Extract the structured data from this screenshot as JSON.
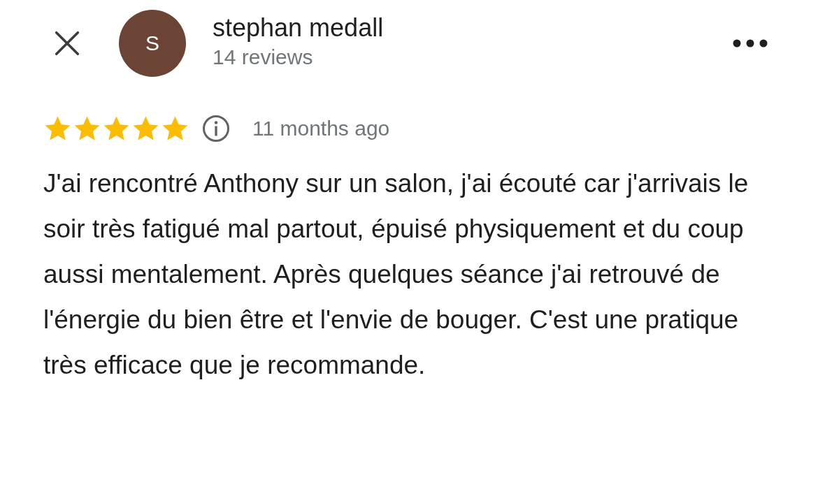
{
  "reviewer": {
    "initial": "S",
    "name": "stephan medall",
    "review_count": "14 reviews"
  },
  "review": {
    "stars": 5,
    "time": "11 months ago",
    "text": "J'ai rencontré Anthony sur un salon, j'ai écouté car j'arrivais le soir très fatigué mal partout, épuisé physiquement et du coup aussi mentalement. Après quelques séance j'ai retrouvé de l'énergie du bien être et l'envie de bouger. C'est une pratique très efficace que je recommande."
  }
}
